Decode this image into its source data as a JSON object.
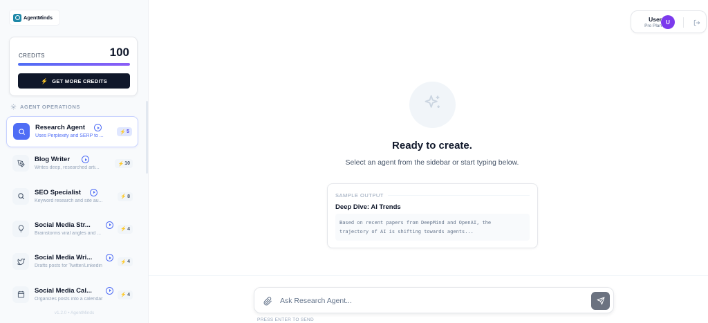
{
  "brand": {
    "name": "AgentMinds"
  },
  "credits": {
    "label": "CREDITS",
    "value": "100",
    "fill_fraction": 1.0,
    "button_label": "GET MORE CREDITS"
  },
  "sidebar": {
    "section_label": "AGENT OPERATIONS",
    "agents": [
      {
        "name": "Research Agent",
        "desc": "Uses Perplexity and SERP to ...",
        "cost": "5",
        "icon": "search-icon",
        "active": true
      },
      {
        "name": "Blog Writer",
        "desc": "Writes deep, researched arti...",
        "cost": "10",
        "icon": "pen-icon",
        "active": false
      },
      {
        "name": "SEO Specialist",
        "desc": "Keyword research and site au...",
        "cost": "8",
        "icon": "search-icon",
        "active": false
      },
      {
        "name": "Social Media Str...",
        "desc": "Brainstorms viral angles and ...",
        "cost": "4",
        "icon": "lightbulb-icon",
        "active": false
      },
      {
        "name": "Social Media Wri...",
        "desc": "Drafts posts for Twitter/Linkedin",
        "cost": "4",
        "icon": "twitter-icon",
        "active": false
      },
      {
        "name": "Social Media Cal...",
        "desc": "Organizes posts into a calendar",
        "cost": "4",
        "icon": "calendar-icon",
        "active": false
      }
    ],
    "version": "v1.2.0 • AgentMinds"
  },
  "user": {
    "name": "User",
    "plan": "Pro Plan",
    "initial": "U"
  },
  "hero": {
    "title": "Ready to create.",
    "subtitle": "Select an agent from the sidebar or start typing below."
  },
  "sample": {
    "label": "SAMPLE OUTPUT",
    "title": "Deep Dive: AI Trends",
    "line1": "Based on recent papers from DeepMind and OpenAI, the",
    "line2": "trajectory of AI is shifting towards agents..."
  },
  "chat": {
    "placeholder": "Ask Research Agent...",
    "hint": "PRESS ENTER TO SEND"
  },
  "colors": {
    "accent": "#4f6df5",
    "dark": "#0f172a",
    "avatar": "#7c3aed",
    "bolt": "#facc15"
  }
}
